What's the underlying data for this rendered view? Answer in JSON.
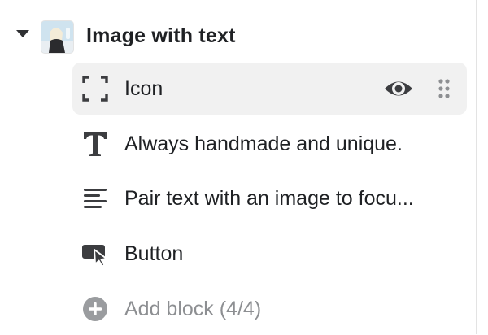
{
  "section": {
    "title": "Image with text",
    "collapse_icon": "caret-down-icon",
    "thumbnail": "image-thumbnail"
  },
  "blocks": [
    {
      "label": "Icon",
      "icon": "icon-placeholder-icon",
      "selected": true,
      "visibility_icon": "eye-icon",
      "drag_icon": "drag-handle-icon"
    },
    {
      "label": "Always handmade and unique.",
      "icon": "heading-text-icon"
    },
    {
      "label": "Pair text with an image to focu...",
      "icon": "paragraph-text-icon"
    },
    {
      "label": "Button",
      "icon": "button-cursor-icon"
    }
  ],
  "add_block": {
    "label": "Add block (4/4)",
    "icon": "plus-circle-icon"
  },
  "colors": {
    "selected_row_bg": "#f1f1f1",
    "text": "#1f2124",
    "muted_text": "#8d8f92",
    "icon": "#3c3d40",
    "add_icon": "#9a9c9f"
  }
}
